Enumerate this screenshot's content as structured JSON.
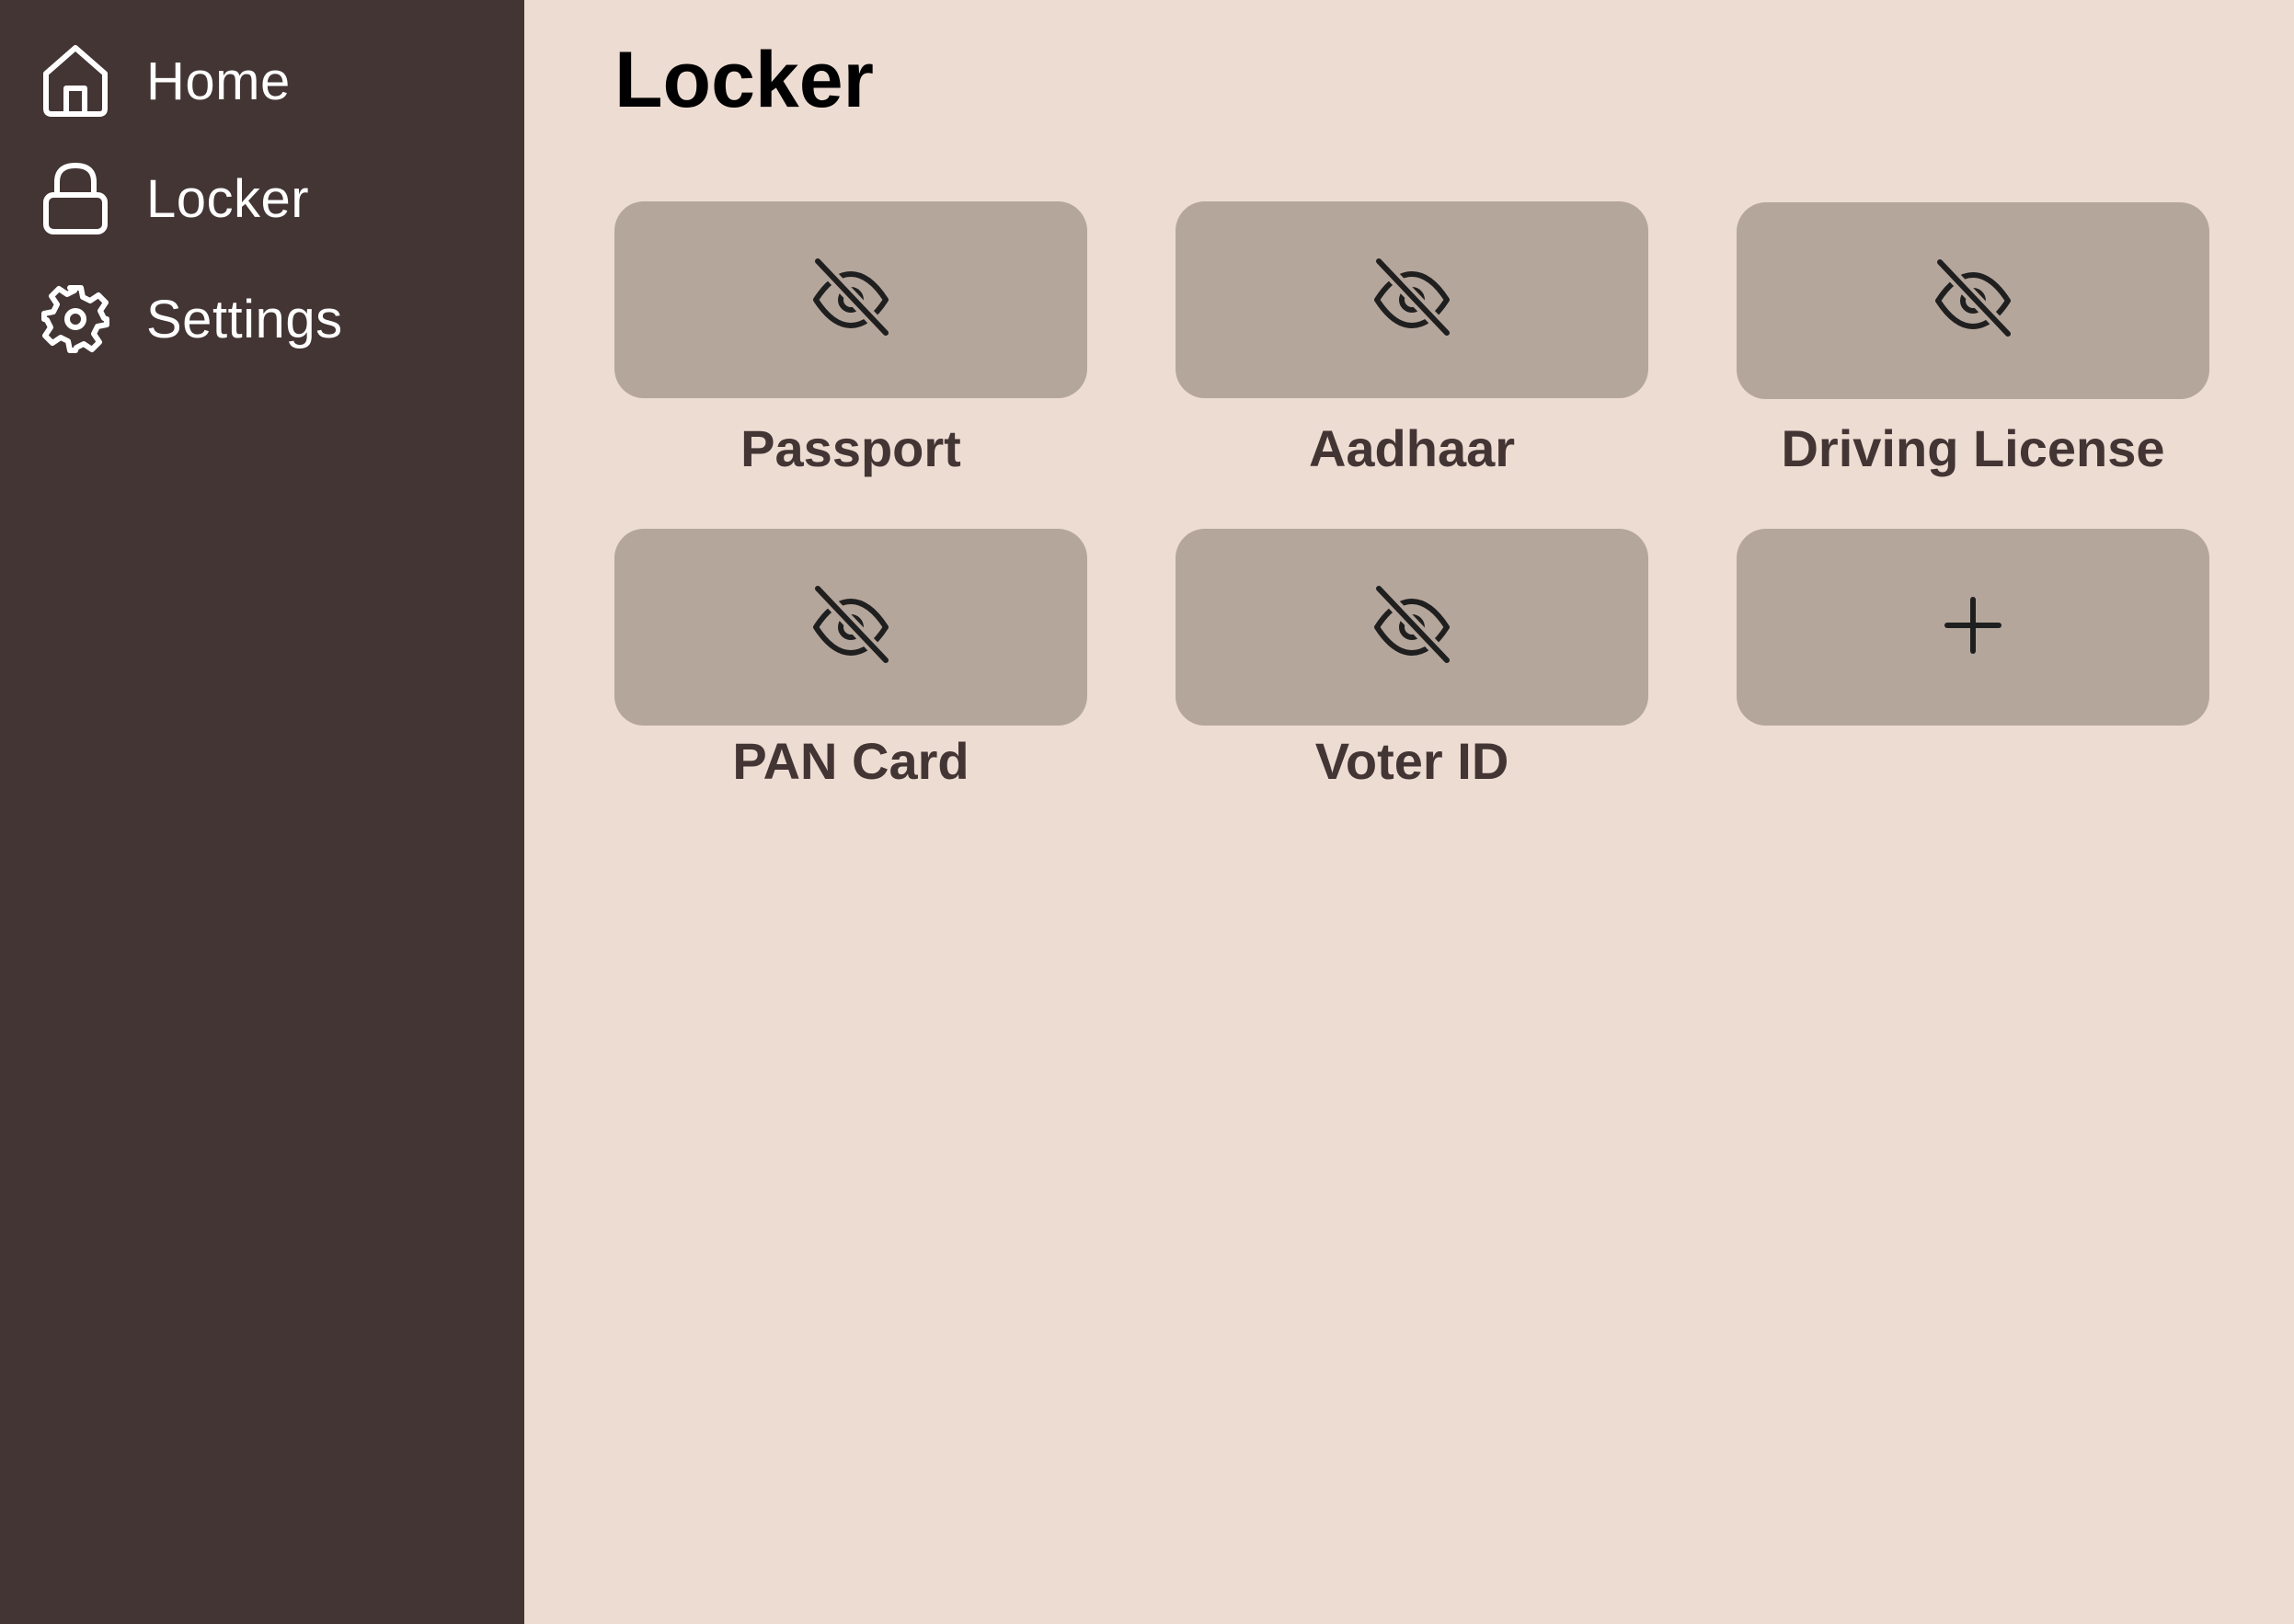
{
  "sidebar": {
    "items": [
      {
        "label": "Home",
        "icon": "home-icon"
      },
      {
        "label": "Locker",
        "icon": "lock-icon"
      },
      {
        "label": "Settings",
        "icon": "gear-icon"
      }
    ]
  },
  "main": {
    "title": "Locker",
    "documents": [
      {
        "label": "Passport",
        "icon": "eye-off-icon"
      },
      {
        "label": "Aadhaar",
        "icon": "eye-off-icon"
      },
      {
        "label": "Driving License",
        "icon": "eye-off-icon"
      },
      {
        "label": "PAN Card",
        "icon": "eye-off-icon"
      },
      {
        "label": "Voter ID",
        "icon": "eye-off-icon"
      }
    ],
    "add_card": {
      "icon": "plus-icon"
    }
  },
  "colors": {
    "sidebar_bg": "#433534",
    "page_bg": "#eddcd2",
    "card_bg": "#b5a69c",
    "card_label": "#433534",
    "icon_dark": "#1f1f1f"
  }
}
